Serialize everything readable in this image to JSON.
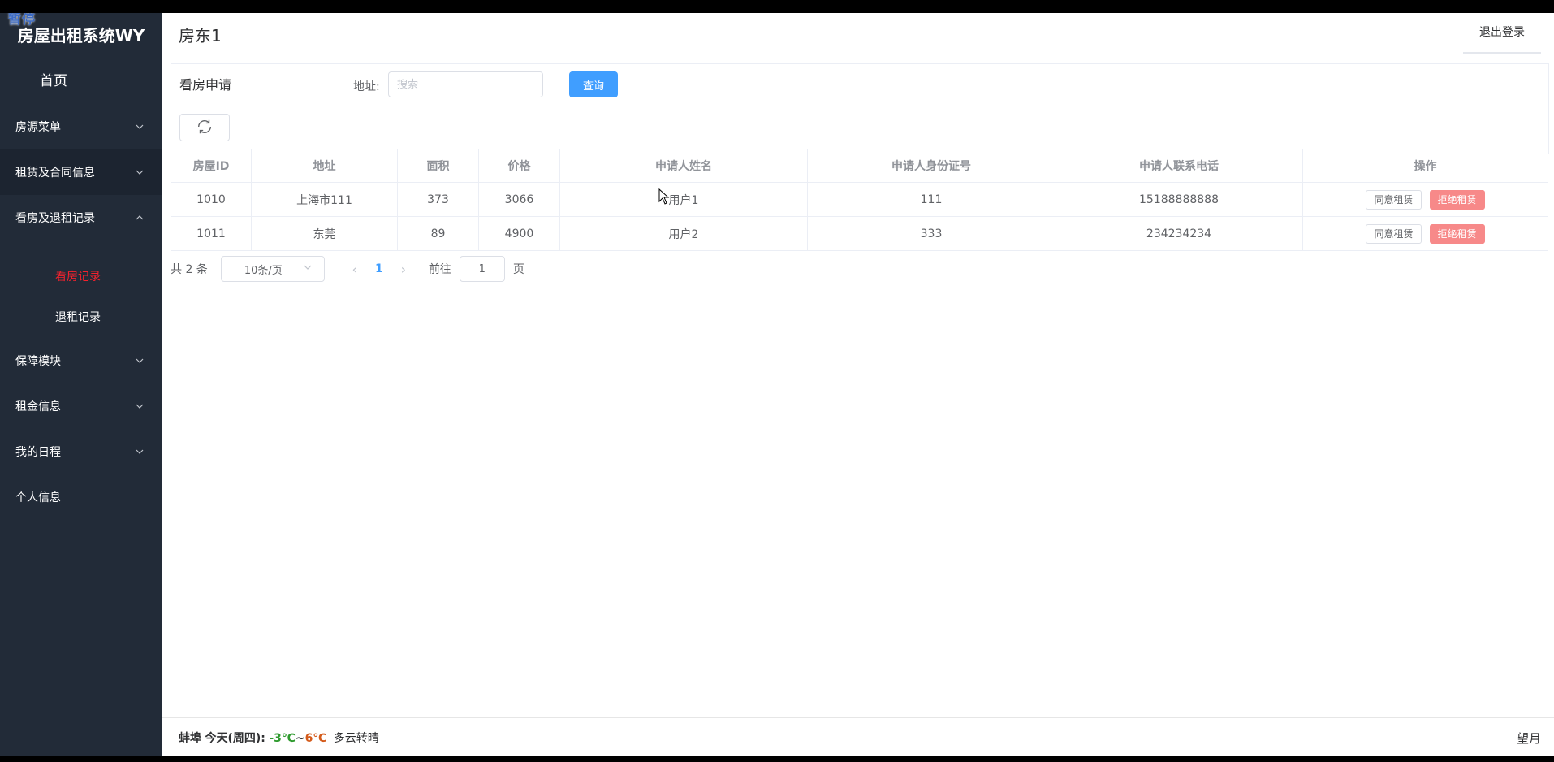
{
  "overlay": {
    "paused_label": "暂停"
  },
  "sidebar": {
    "brand": "房屋出租系统WY",
    "home": "首页",
    "menus": [
      {
        "label": "房源菜单"
      },
      {
        "label": "租赁及合同信息"
      },
      {
        "label": "看房及退租记录"
      },
      {
        "label": "保障模块"
      },
      {
        "label": "租金信息"
      },
      {
        "label": "我的日程"
      },
      {
        "label": "个人信息"
      }
    ],
    "submenu": [
      {
        "label": "看房记录"
      },
      {
        "label": "退租记录"
      }
    ]
  },
  "header": {
    "title": "房东1",
    "logout": "退出登录"
  },
  "panel": {
    "title": "看房申请",
    "address_label": "地址:",
    "search_placeholder": "搜索",
    "query_button": "查询"
  },
  "table": {
    "columns": [
      "房屋ID",
      "地址",
      "面积",
      "价格",
      "申请人姓名",
      "申请人身份证号",
      "申请人联系电话",
      "操作"
    ],
    "rows": [
      {
        "id": "1010",
        "address": "上海市111",
        "area": "373",
        "price": "3066",
        "name": "用户1",
        "idcard": "111",
        "phone": "15188888888"
      },
      {
        "id": "1011",
        "address": "东莞",
        "area": "89",
        "price": "4900",
        "name": "用户2",
        "idcard": "333",
        "phone": "234234234"
      }
    ],
    "agree_label": "同意租赁",
    "reject_label": "拒绝租赁"
  },
  "pagination": {
    "total": "共 2 条",
    "page_size": "10条/页",
    "current_page": "1",
    "goto_label": "前往",
    "goto_value": "1",
    "page_suffix": "页"
  },
  "footer": {
    "city": "蚌埠",
    "today": "今天(周四):",
    "low": "-3℃",
    "sep": "~",
    "high": "6℃",
    "desc": "多云转晴",
    "moon": "望月"
  },
  "colors": {
    "sidebar_bg": "#222b38",
    "primary": "#409eff",
    "danger": "#f78989",
    "active_menu": "#f5222d"
  }
}
